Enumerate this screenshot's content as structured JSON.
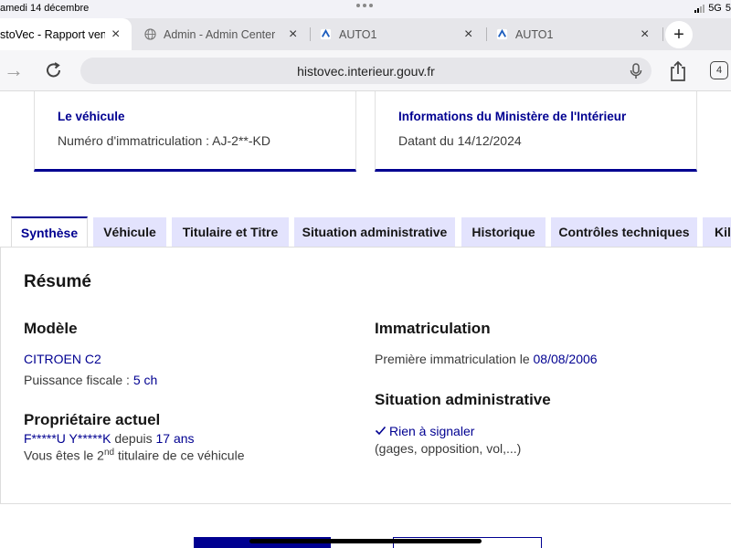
{
  "status": {
    "date": "amedi 14 décembre",
    "network": "5G",
    "battery": "5"
  },
  "browser_tabs": [
    {
      "title": "stoVec - Rapport vend",
      "active": true
    },
    {
      "title": "Admin - Admin Center",
      "active": false
    },
    {
      "title": "AUTO1",
      "active": false
    },
    {
      "title": "AUTO1",
      "active": false
    }
  ],
  "tab_count": "4",
  "url": "histovec.interieur.gouv.fr",
  "cards": {
    "vehicle": {
      "title": "Le véhicule",
      "text": "Numéro d'immatriculation : AJ-2**-KD"
    },
    "ministry": {
      "title": "Informations du Ministère de l'Intérieur",
      "text": "Datant du 14/12/2024"
    }
  },
  "content_tabs": [
    "Synthèse",
    "Véhicule",
    "Titulaire et Titre",
    "Situation administrative",
    "Historique",
    "Contrôles techniques",
    "Kilo"
  ],
  "summary": {
    "title": "Résumé",
    "model": {
      "heading": "Modèle",
      "name": "CITROEN C2",
      "power_label": "Puissance fiscale : ",
      "power_value": "5 ch"
    },
    "owner": {
      "heading": "Propriétaire actuel",
      "name": "F*****U Y*****K",
      "since_label": " depuis ",
      "since_value": "17 ans",
      "rank_prefix": "Vous êtes le 2",
      "rank_sup": "nd",
      "rank_suffix": " titulaire de ce véhicule"
    },
    "registration": {
      "heading": "Immatriculation",
      "first_label": "Première immatriculation le ",
      "first_date": "08/08/2006"
    },
    "admin": {
      "heading": "Situation administrative",
      "status": "Rien à signaler",
      "details": "(gages, opposition, vol,...)"
    }
  },
  "colors": {
    "accent": "#000091",
    "tab_bg": "#e3e3fd"
  }
}
